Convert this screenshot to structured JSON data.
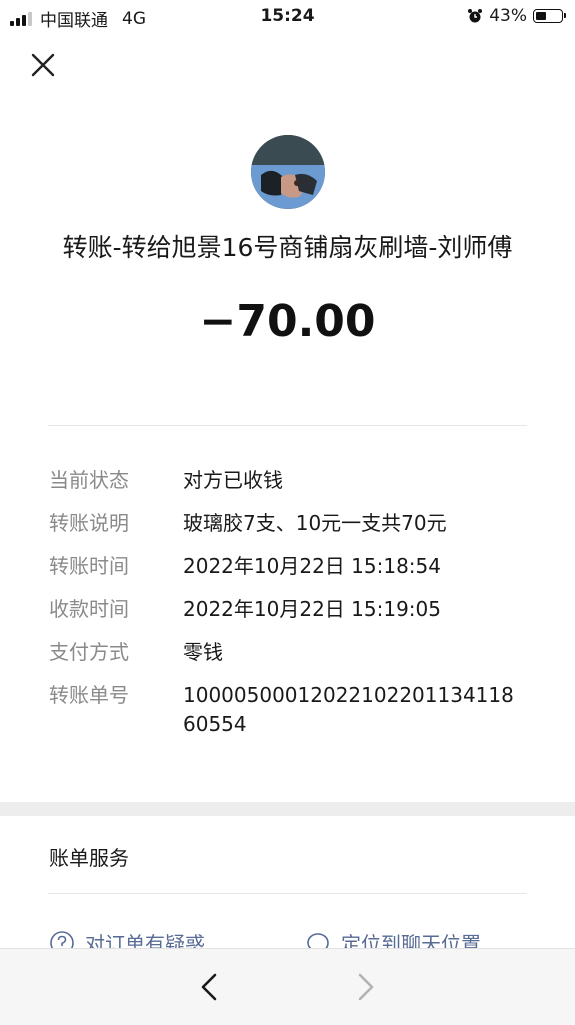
{
  "status_bar": {
    "carrier": "中国联通",
    "network": "4G",
    "time": "15:24",
    "battery_percent": "43%",
    "battery_level": 0.43
  },
  "header": {
    "close_icon": "close-icon"
  },
  "transfer": {
    "title": "转账-转给旭景16号商铺扇灰刷墙-刘师傅",
    "amount": "−70.00"
  },
  "details": [
    {
      "label": "当前状态",
      "value": "对方已收钱"
    },
    {
      "label": "转账说明",
      "value": "玻璃胶7支、10元一支共70元"
    },
    {
      "label": "转账时间",
      "value": "2022年10月22日 15:18:54"
    },
    {
      "label": "收款时间",
      "value": "2022年10月22日 15:19:05"
    },
    {
      "label": "支付方式",
      "value": "零钱"
    },
    {
      "label": "转账单号",
      "value": "1000050001202210220113411860554"
    }
  ],
  "bill_service": {
    "title": "账单服务",
    "links": [
      {
        "label": "对订单有疑惑",
        "icon": "question-circle-icon"
      },
      {
        "label": "定位到聊天位置",
        "icon": "chat-bubble-icon"
      }
    ]
  },
  "nav": {
    "back_icon": "chevron-left-icon",
    "forward_icon": "chevron-right-icon"
  },
  "colors": {
    "link": "#576b95",
    "label": "#8a8a8a",
    "text": "#191919",
    "section_gap": "#ededed"
  }
}
